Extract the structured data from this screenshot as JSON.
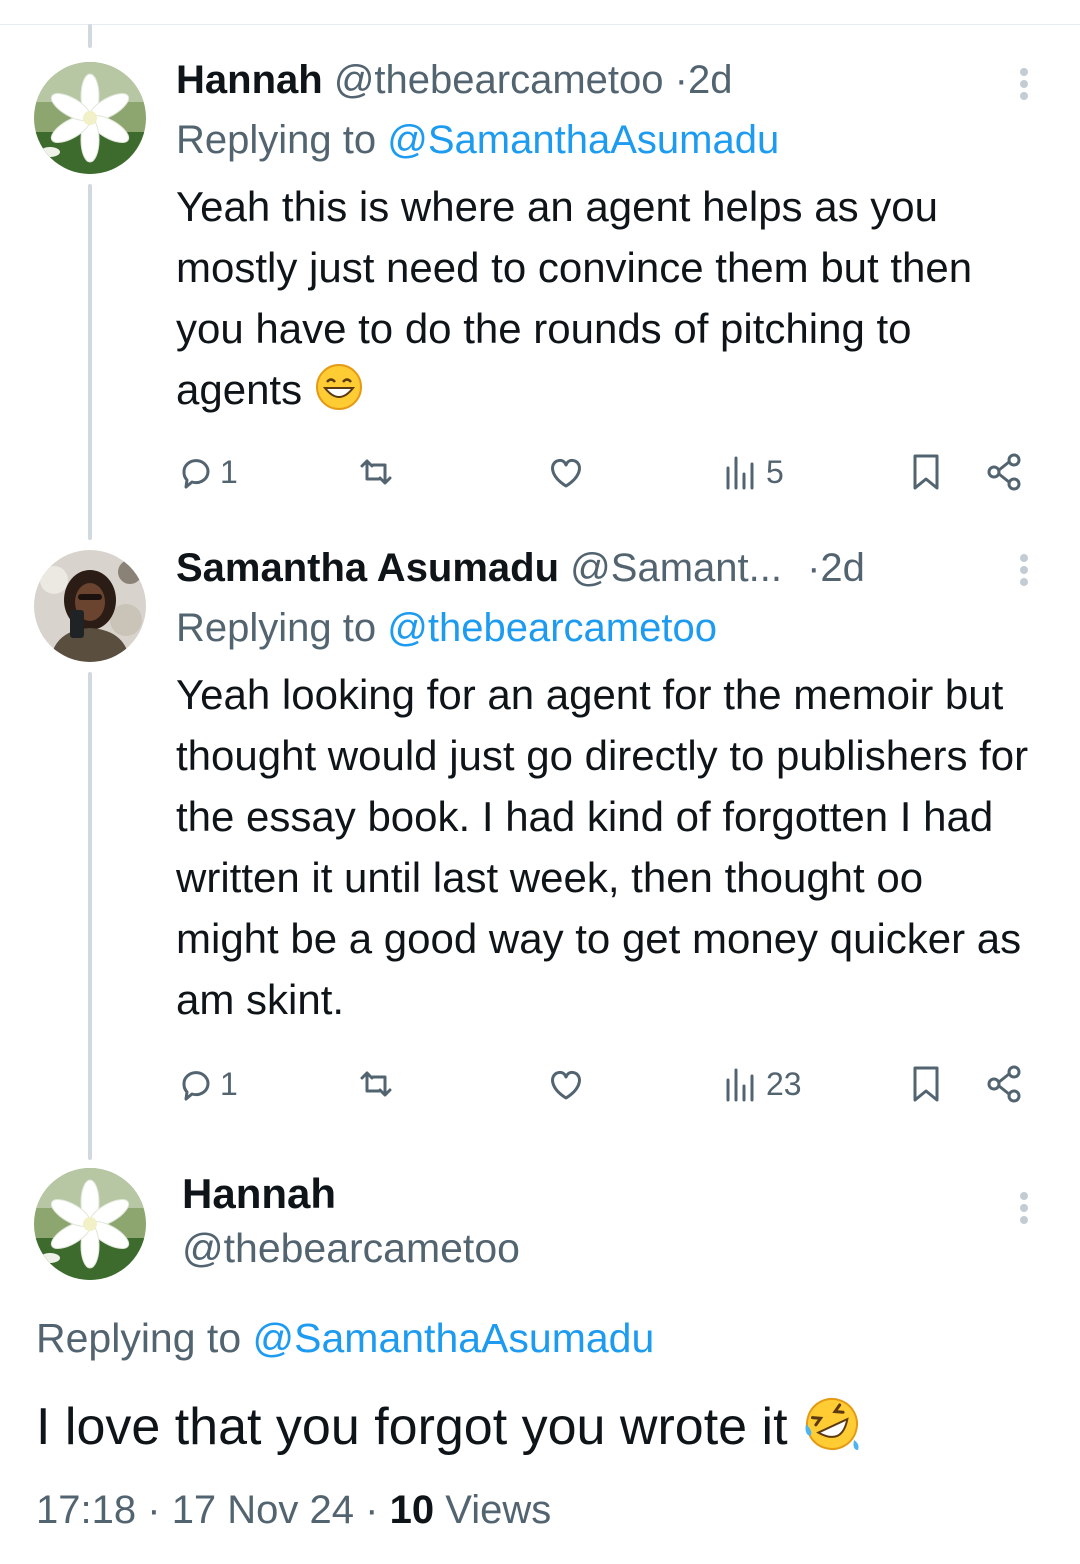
{
  "tweets": [
    {
      "name": "Hannah",
      "handle": "@thebearcametoo",
      "time": "2d",
      "replying_label": "Replying to",
      "replying_to": "@SamanthaAsumadu",
      "text": "Yeah this is where an agent helps as you mostly just need to convince them but then you have to do the rounds of pitching to agents",
      "emoji": "grinning-face-emoji",
      "replies": "1",
      "views": "5"
    },
    {
      "name": "Samantha Asumadu",
      "handle": "@Samant...",
      "time": "2d",
      "replying_label": "Replying to",
      "replying_to": "@thebearcametoo",
      "text": "Yeah looking for an agent for the memoir but thought would just go directly to publishers for the essay book. I had kind of forgotten I had written it until last week, then thought oo might be a good way to get money quicker as am skint.",
      "replies": "1",
      "views": "23"
    }
  ],
  "main_tweet": {
    "name": "Hannah",
    "handle": "@thebearcametoo",
    "replying_label": "Replying to",
    "replying_to": "@SamanthaAsumadu",
    "text": "I love that you forgot you wrote it",
    "emoji": "rolling-on-floor-laughing-emoji",
    "time": "17:18",
    "date": "17 Nov 24",
    "views_count": "10",
    "views_label": "Views"
  },
  "colors": {
    "link": "#1d9bf0",
    "secondary_text": "#536471",
    "primary_text": "#0f1419",
    "thread_line": "#cfd9de"
  }
}
